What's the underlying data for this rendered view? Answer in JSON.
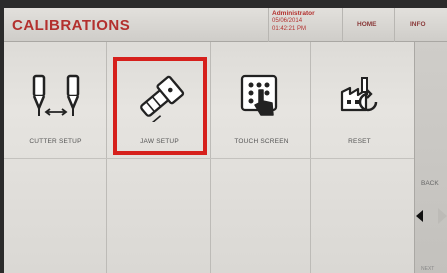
{
  "header": {
    "title": "CALIBRATIONS",
    "user": "Administrator",
    "date": "05/06/2014",
    "time": "01:42:21 PM",
    "home_label": "HOME",
    "info_label": "INFO"
  },
  "tiles": [
    {
      "label": "CUTTER SETUP",
      "icon": "cutter-setup-icon",
      "selected": false
    },
    {
      "label": "JAW SETUP",
      "icon": "jaw-setup-icon",
      "selected": true
    },
    {
      "label": "TOUCH SCREEN",
      "icon": "touch-screen-icon",
      "selected": false
    },
    {
      "label": "RESET",
      "icon": "reset-factory-icon",
      "selected": false
    }
  ],
  "nav": {
    "back_label": "BACK",
    "next_label": "NEXT"
  },
  "colors": {
    "accent_red": "#b3302e",
    "selection_red": "#d6201c"
  }
}
